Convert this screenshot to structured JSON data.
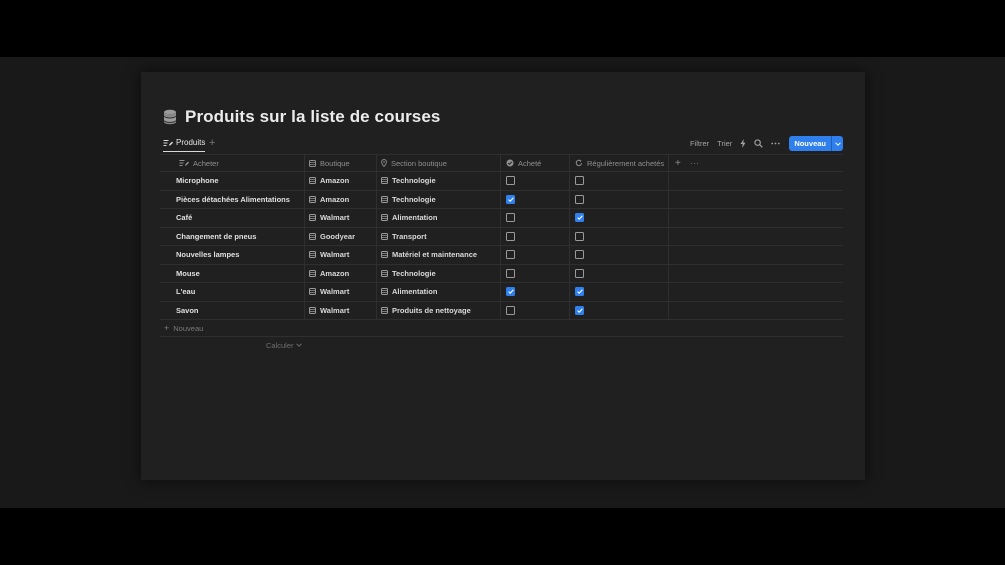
{
  "page": {
    "title": "Produits sur la liste de courses",
    "accent_color": "#2f80ed",
    "title_icon": "database-icon"
  },
  "view": {
    "tab_label": "Produits",
    "tab_icon": "list-edit-icon",
    "add_view_label": "+"
  },
  "toolbar": {
    "filter_label": "Filtrer",
    "sort_label": "Trier",
    "new_label": "Nouveau",
    "icons": [
      "lightning-icon",
      "search-icon",
      "more-icon",
      "chevron-down-icon"
    ]
  },
  "columns": {
    "acheter": "Acheter",
    "boutique": "Boutique",
    "section": "Section boutique",
    "achete": "Acheté",
    "regulier": "Régulièrement achetés",
    "add": "+",
    "more": "···"
  },
  "rows": [
    {
      "name": "Microphone",
      "boutique": "Amazon",
      "section": "Technologie",
      "achete": false,
      "regulier": false
    },
    {
      "name": "Pièces détachées Alimentations",
      "boutique": "Amazon",
      "section": "Technologie",
      "achete": true,
      "regulier": false
    },
    {
      "name": "Café",
      "boutique": "Walmart",
      "section": "Alimentation",
      "achete": false,
      "regulier": true
    },
    {
      "name": "Changement de pneus",
      "boutique": "Goodyear",
      "section": "Transport",
      "achete": false,
      "regulier": false
    },
    {
      "name": "Nouvelles lampes",
      "boutique": "Walmart",
      "section": "Matériel et maintenance",
      "achete": false,
      "regulier": false
    },
    {
      "name": "Mouse",
      "boutique": "Amazon",
      "section": "Technologie",
      "achete": false,
      "regulier": false
    },
    {
      "name": "L'eau",
      "boutique": "Walmart",
      "section": "Alimentation",
      "achete": true,
      "regulier": true
    },
    {
      "name": "Savon",
      "boutique": "Walmart",
      "section": "Produits de nettoyage",
      "achete": false,
      "regulier": true
    }
  ],
  "footer": {
    "new_row_label": "Nouveau",
    "calculate_label": "Calculer"
  }
}
